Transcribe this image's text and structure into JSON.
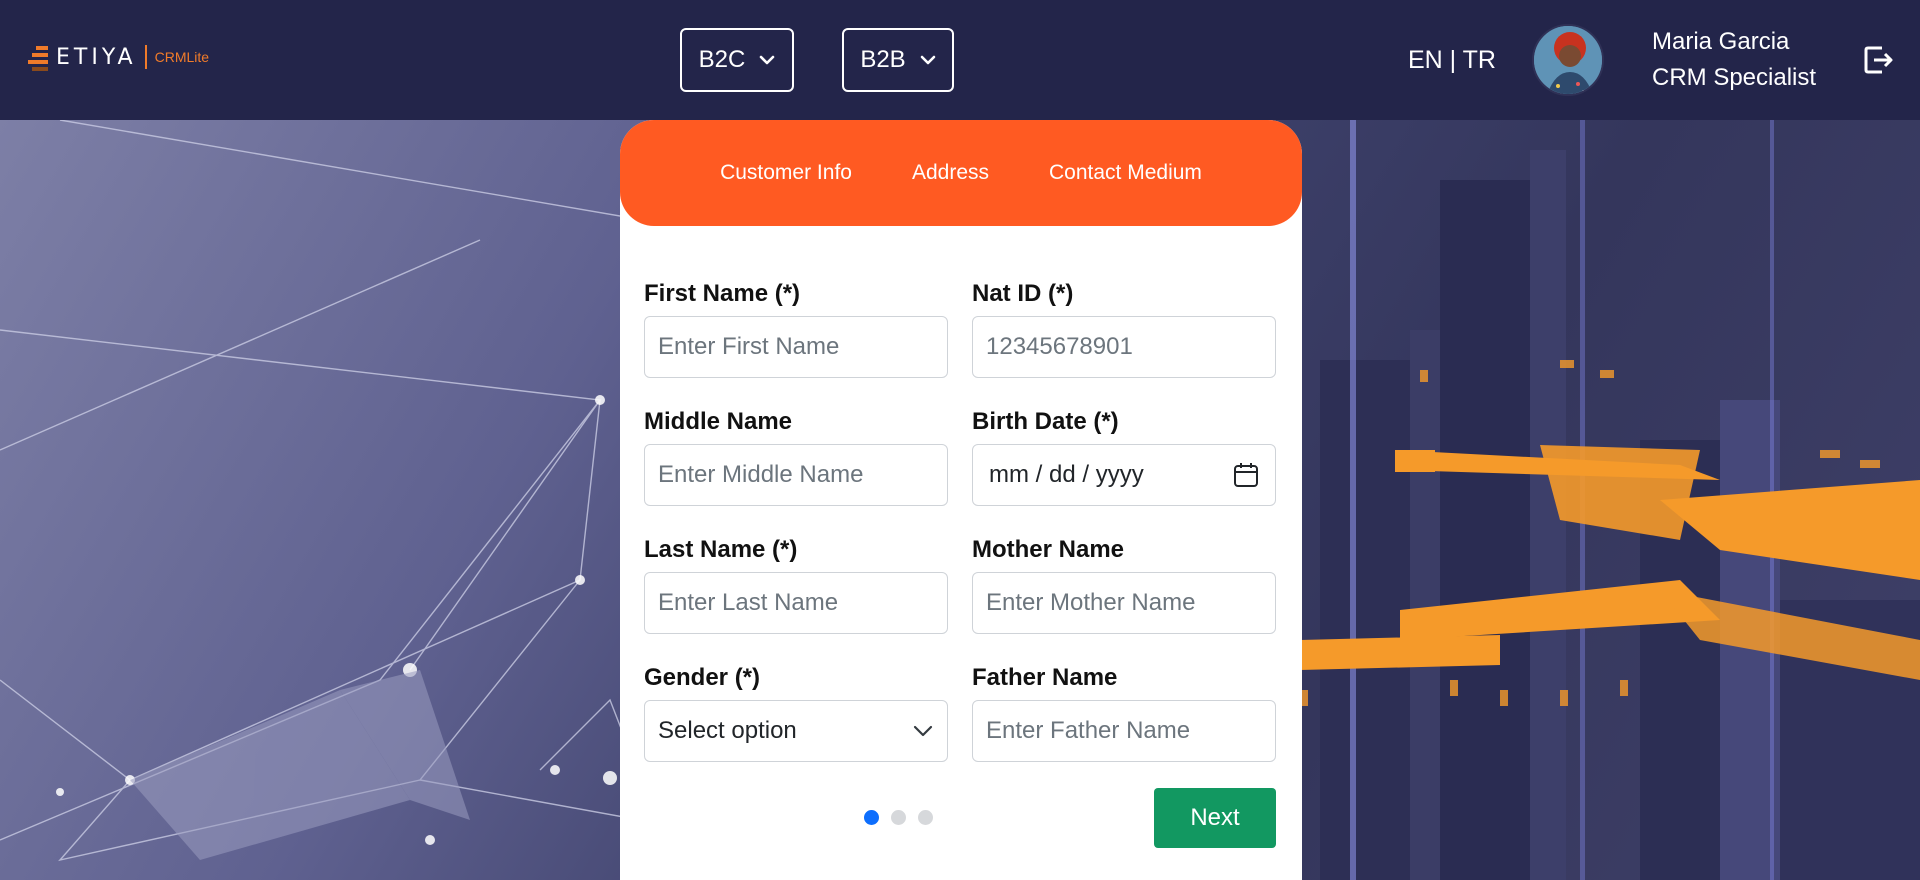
{
  "header": {
    "logo_text": "ETIYA",
    "logo_sub": "CRMLite",
    "segments": [
      {
        "label": "B2C",
        "icon": "chevron-down-icon"
      },
      {
        "label": "B2B",
        "icon": "chevron-down-icon"
      }
    ],
    "language": "EN | TR",
    "user": {
      "name": "Maria Garcia",
      "role": "CRM Specialist"
    },
    "logout_icon": "logout-icon"
  },
  "tabs": [
    {
      "label": "Customer Info"
    },
    {
      "label": "Address"
    },
    {
      "label": "Contact Medium"
    }
  ],
  "form": {
    "first_name": {
      "label": "First Name (*)",
      "placeholder": "Enter First Name"
    },
    "nat_id": {
      "label": "Nat ID (*)",
      "placeholder": "12345678901"
    },
    "middle_name": {
      "label": "Middle Name",
      "placeholder": "Enter Middle Name"
    },
    "birth_date": {
      "label": "Birth Date (*)",
      "value": "mm / dd / yyyy",
      "icon": "calendar-icon"
    },
    "last_name": {
      "label": "Last Name (*)",
      "placeholder": "Enter Last Name"
    },
    "mother_name": {
      "label": "Mother Name",
      "placeholder": "Enter Mother Name"
    },
    "gender": {
      "label": "Gender (*)",
      "value": "Select option",
      "icon": "chevron-down-icon"
    },
    "father_name": {
      "label": "Father Name",
      "placeholder": "Enter Father Name"
    }
  },
  "pagination": {
    "total": 3,
    "active": 1
  },
  "next_label": "Next",
  "colors": {
    "header_bg": "#23254a",
    "tab_bar": "#ff5a22",
    "next_button": "#129861",
    "active_dot": "#0d6efd"
  }
}
